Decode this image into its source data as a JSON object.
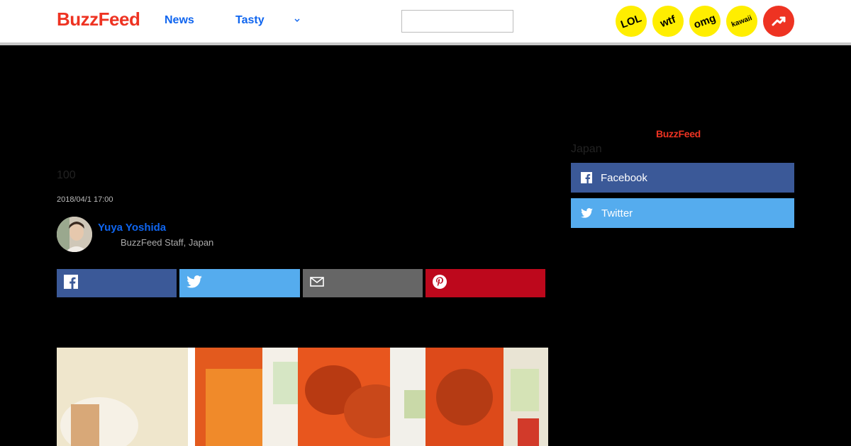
{
  "header": {
    "logo": "BuzzFeed",
    "nav": [
      {
        "label": "News"
      },
      {
        "label": "Tasty"
      }
    ],
    "search": {
      "value": "",
      "placeholder": ""
    },
    "badges": [
      {
        "label": "LOL",
        "icon": "lol-badge-icon"
      },
      {
        "label": "wtf",
        "icon": "wtf-badge-icon"
      },
      {
        "label": "omg",
        "icon": "omg-badge-icon"
      },
      {
        "label": "kawaii",
        "icon": "kawaii-badge-icon"
      }
    ],
    "trending_icon": "trending-arrow-icon"
  },
  "article": {
    "title": "100",
    "date": "2018/04/1 17:00",
    "author": {
      "name": "Yuya Yoshida",
      "role": "BuzzFeed Staff, Japan"
    },
    "share_buttons": [
      {
        "icon": "facebook-icon",
        "color": "#3b5998"
      },
      {
        "icon": "twitter-icon",
        "color": "#55acee"
      },
      {
        "icon": "mail-icon",
        "color": "#666666"
      },
      {
        "icon": "pinterest-icon",
        "color": "#bd081c"
      }
    ]
  },
  "sidebar": {
    "logo": "BuzzFeed",
    "label": "Japan",
    "follow": [
      {
        "label": "Facebook",
        "icon": "facebook-icon",
        "color": "#3b5998"
      },
      {
        "label": "Twitter",
        "icon": "twitter-icon",
        "color": "#55acee"
      }
    ]
  },
  "colors": {
    "brand_red": "#ee3322",
    "link_blue": "#0f65ef",
    "badge_yellow": "#ffee00"
  }
}
